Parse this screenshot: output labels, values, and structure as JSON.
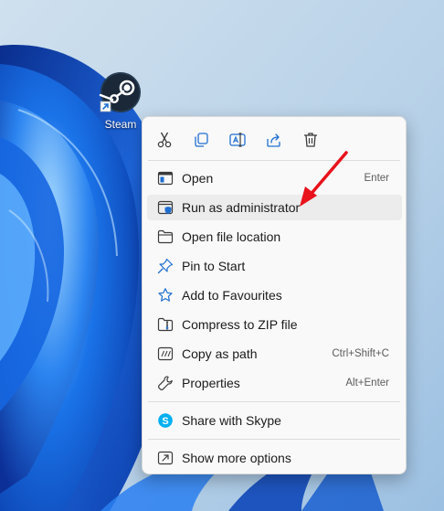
{
  "desktop": {
    "icons": [
      {
        "label": "Steam",
        "icon": "steam-icon"
      }
    ]
  },
  "context_menu": {
    "quick_actions": [
      {
        "name": "cut",
        "icon": "scissors-icon"
      },
      {
        "name": "copy",
        "icon": "copy-icon"
      },
      {
        "name": "rename",
        "icon": "rename-icon"
      },
      {
        "name": "share",
        "icon": "share-icon"
      },
      {
        "name": "delete",
        "icon": "trash-icon"
      }
    ],
    "items": [
      {
        "label": "Open",
        "shortcut": "Enter",
        "icon": "open-window-icon"
      },
      {
        "label": "Run as administrator",
        "shortcut": "",
        "icon": "shield-window-icon"
      },
      {
        "label": "Open file location",
        "shortcut": "",
        "icon": "folder-icon"
      },
      {
        "label": "Pin to Start",
        "shortcut": "",
        "icon": "pin-icon"
      },
      {
        "label": "Add to Favourites",
        "shortcut": "",
        "icon": "star-icon"
      },
      {
        "label": "Compress to ZIP file",
        "shortcut": "",
        "icon": "zip-folder-icon"
      },
      {
        "label": "Copy as path",
        "shortcut": "Ctrl+Shift+C",
        "icon": "path-icon"
      },
      {
        "label": "Properties",
        "shortcut": "Alt+Enter",
        "icon": "wrench-icon"
      },
      {
        "label": "Share with Skype",
        "shortcut": "",
        "icon": "skype-icon"
      },
      {
        "label": "Show more options",
        "shortcut": "",
        "icon": "more-options-icon"
      }
    ]
  },
  "colors": {
    "accent": "#0067c0",
    "menu_background": "#f9f9f9",
    "highlight": "#ececec",
    "annotation_arrow": "#e8131b",
    "skype": "#00aff0"
  }
}
